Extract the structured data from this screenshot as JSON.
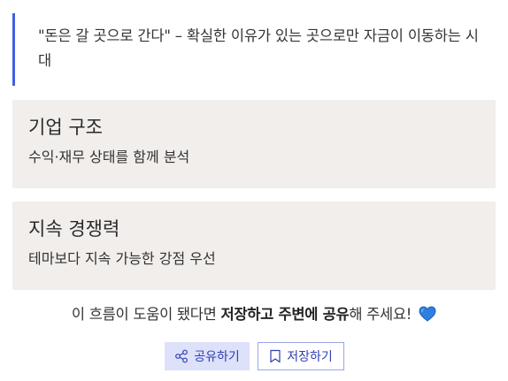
{
  "quote": {
    "text": "\"돈은 갈 곳으로 간다\" – 확실한 이유가 있는 곳으로만 자금이 이동하는 시대"
  },
  "cards": [
    {
      "title": "기업 구조",
      "description": "수익·재무 상태를 함께 분석"
    },
    {
      "title": "지속 경쟁력",
      "description": "테마보다 지속 가능한 강점 우선"
    }
  ],
  "cta": {
    "prefix": "이 흐름이 도움이 됐다면 ",
    "bold1": "저장하고 주변에 공유",
    "suffix": "해 주세요!",
    "heart_icon": "blue-heart-icon"
  },
  "buttons": {
    "share_label": "공유하기",
    "save_label": "저장하기",
    "share_icon": "share-icon",
    "save_icon": "bookmark-icon"
  },
  "colors": {
    "accent": "#3f5fe4",
    "card_bg": "#f1eeec",
    "share_bg": "#dde1fa",
    "button_text": "#2f3fb0",
    "heart": "#2f7fe0"
  }
}
